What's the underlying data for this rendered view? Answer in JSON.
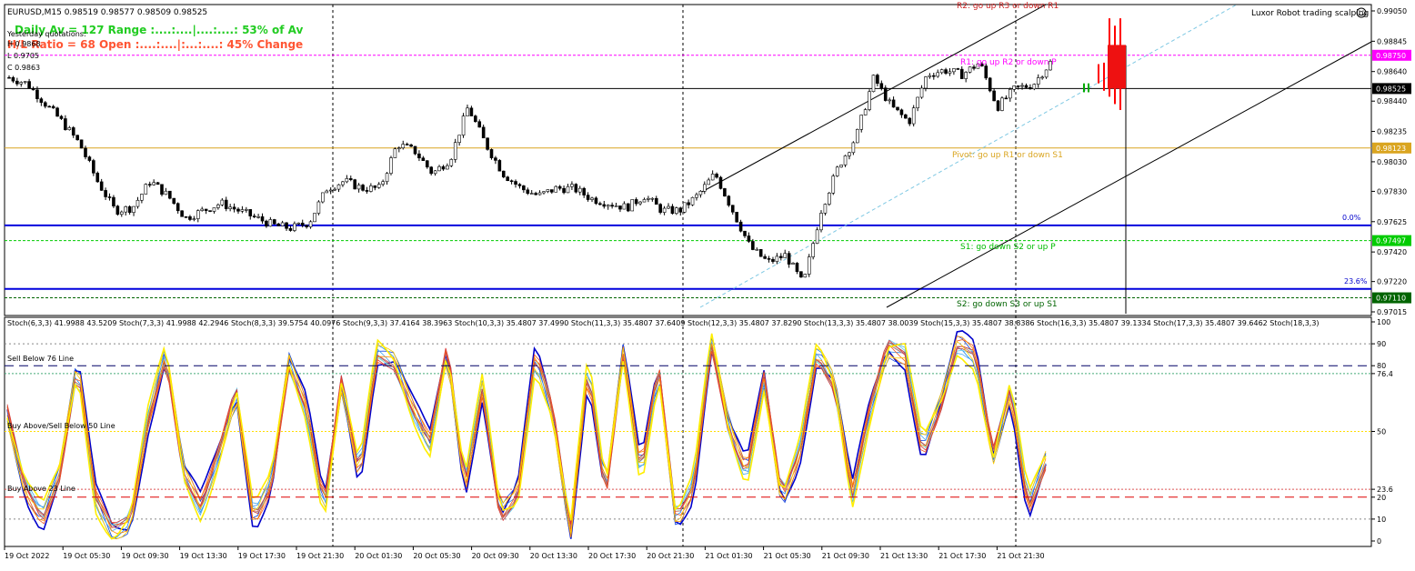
{
  "window": {
    "symbol_line": "EURUSD,M15  0.98519 0.98577 0.98509 0.98525",
    "robot_label": "Luxor Robot trading scalping",
    "colors": {
      "background": "#ffffff",
      "grid": "#000000",
      "bull": "#000000",
      "bear": "#000000",
      "price_line": "#000000",
      "accent_red": "#ff0000"
    }
  },
  "info": {
    "daily_line": "Daily Av = 127  Range :....:....|....:....:  53% of Av",
    "ratio_line": "H/L Ratio = 68  Open :....:....|:...:....:  45% Change",
    "yesterday_title": "Yesterday quotations:",
    "yesterday_h": "H 0.9868",
    "yesterday_l": "L 0.9705",
    "yesterday_c": "C 0.9863"
  },
  "levels": {
    "r2": "R2: go up R3 or down R1",
    "r1": "R1: go up R2 or down P",
    "pivot": "Pivot: go up R1 or down S1",
    "s1": "S1: go down S2 or up P",
    "s2": "S2: go down S3 or up S1",
    "fib_0": "0.0%",
    "fib_236": "23.6%"
  },
  "price_axis": {
    "ticks": [
      "0.99050",
      "0.98845",
      "0.98640",
      "0.98440",
      "0.98235",
      "0.98030",
      "0.97830",
      "0.97625",
      "0.97420",
      "0.97220",
      "0.97015"
    ],
    "badges": [
      {
        "label": "0.98750",
        "value": 0.9875,
        "color": "#ff00ff"
      },
      {
        "label": "0.98525",
        "value": 0.98525,
        "color": "#000000"
      },
      {
        "label": "0.98123",
        "value": 0.98123,
        "color": "#daa520"
      },
      {
        "label": "0.97497",
        "value": 0.97497,
        "color": "#00cc00"
      },
      {
        "label": "0.97110",
        "value": 0.9711,
        "color": "#006400"
      }
    ]
  },
  "stoch": {
    "header": "Stoch(6,3,3) 41.9988 43.5209  Stoch(7,3,3) 41.9988 42.2946  Stoch(8,3,3) 39.5754 40.0976  Stoch(9,3,3) 37.4164 38.3963  Stoch(10,3,3) 35.4807 37.4990  Stoch(11,3,3) 35.4807 37.6409  Stoch(12,3,3) 35.4807 37.8290  Stoch(13,3,3) 35.4807 38.0039  Stoch(15,3,3) 35.4807 38.8386  Stoch(16,3,3) 35.4807 39.1334  Stoch(17,3,3) 35.4807 39.6462  Stoch(18,3,3)",
    "sell76": "Sell Below 76 Line",
    "mid50": "Buy Above/Sell Below 50 Line",
    "buy23": "Buy Above 23 Line",
    "axis_ticks": [
      "100",
      "90",
      "80",
      "76.4",
      "50",
      "23.6",
      "20",
      "10",
      "0"
    ]
  },
  "time_axis": {
    "labels": [
      "19 Oct 2022",
      "19 Oct 05:30",
      "19 Oct 09:30",
      "19 Oct 13:30",
      "19 Oct 17:30",
      "19 Oct 21:30",
      "20 Oct 01:30",
      "20 Oct 05:30",
      "20 Oct 09:30",
      "20 Oct 13:30",
      "20 Oct 17:30",
      "20 Oct 21:30",
      "21 Oct 01:30",
      "21 Oct 05:30",
      "21 Oct 09:30",
      "21 Oct 13:30",
      "21 Oct 17:30",
      "21 Oct 21:30"
    ]
  },
  "chart_data": {
    "type": "candlestick",
    "symbol": "EURUSD",
    "timeframe": "M15",
    "ylim": [
      0.97015,
      0.9905
    ],
    "last_price": 0.98525,
    "levels": {
      "R1": 0.9875,
      "P": 0.98123,
      "S1": 0.97497,
      "S2": 0.9711,
      "fib_0": 0.976,
      "fib_23_6": 0.9717
    },
    "close_path": [
      0.986,
      0.9856,
      0.9843,
      0.983,
      0.9815,
      0.979,
      0.977,
      0.9772,
      0.979,
      0.978,
      0.9765,
      0.977,
      0.9775,
      0.977,
      0.9765,
      0.976,
      0.9758,
      0.9762,
      0.9785,
      0.979,
      0.9785,
      0.9785,
      0.9815,
      0.981,
      0.9795,
      0.9805,
      0.984,
      0.9815,
      0.9795,
      0.9785,
      0.978,
      0.9785,
      0.9785,
      0.9778,
      0.9775,
      0.9772,
      0.978,
      0.977,
      0.977,
      0.978,
      0.9795,
      0.977,
      0.9745,
      0.9735,
      0.974,
      0.972,
      0.977,
      0.98,
      0.982,
      0.986,
      0.984,
      0.983,
      0.9862,
      0.9865,
      0.9862,
      0.987,
      0.984,
      0.98525,
      0.9855,
      0.987
    ],
    "stochastic": {
      "periods": [
        6,
        7,
        8,
        9,
        10,
        11,
        12,
        13,
        15,
        16,
        17,
        18
      ],
      "last_values": [
        41.9988,
        41.9988,
        39.5754,
        37.4164,
        35.4807,
        35.4807,
        35.4807,
        35.4807,
        35.4807,
        35.4807,
        35.4807
      ],
      "levels": [
        76.4,
        50,
        23.6
      ],
      "ylim": [
        0,
        100
      ],
      "path": [
        60,
        25,
        10,
        30,
        80,
        20,
        5,
        10,
        55,
        85,
        30,
        15,
        40,
        70,
        10,
        25,
        80,
        60,
        15,
        75,
        30,
        85,
        80,
        60,
        45,
        90,
        25,
        70,
        10,
        20,
        85,
        60,
        5,
        80,
        20,
        85,
        30,
        80,
        10,
        25,
        90,
        50,
        30,
        75,
        20,
        40,
        85,
        70,
        20,
        60,
        90,
        85,
        40,
        60,
        90,
        85,
        40,
        70,
        15,
        35
      ]
    }
  }
}
